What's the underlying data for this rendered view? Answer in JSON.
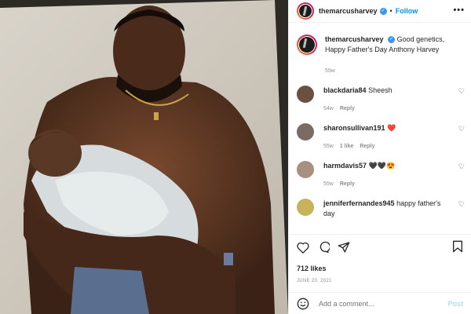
{
  "post": {
    "username": "themarcusharvey",
    "follow_label": "Follow",
    "more_label": "•••",
    "caption_user": "themarcusharvey",
    "caption_text": "Good genetics, Happy Father's Day Anthony Harvey",
    "caption_age": "55w",
    "likes": "712 likes",
    "date": "JUNE 20, 2021",
    "add_comment_placeholder": "Add a comment...",
    "post_label": "Post"
  },
  "comments": [
    {
      "user": "blackdaria84",
      "text": "Sheesh",
      "age": "54w",
      "likes": "",
      "reply": "Reply",
      "avatar_color": "#6b5040"
    },
    {
      "user": "sharonsullivan191",
      "text": "❤️",
      "age": "55w",
      "likes": "1 like",
      "reply": "Reply",
      "avatar_color": "#7c6b62"
    },
    {
      "user": "harmdavis57",
      "text": "🖤🖤😍",
      "age": "55w",
      "likes": "",
      "reply": "Reply",
      "avatar_color": "#a88f7f"
    },
    {
      "user": "jenniferfernandes945",
      "text": "happy father's day",
      "age": "",
      "likes": "",
      "reply": "",
      "avatar_color": "#c9b25c"
    }
  ],
  "icons": [
    "heart-icon",
    "comment-icon",
    "share-icon",
    "bookmark-icon",
    "emoji-icon",
    "verified-icon"
  ],
  "colors": {
    "accent": "#0095f6",
    "verified": "#3897f0",
    "muted": "#8e8e8e"
  }
}
